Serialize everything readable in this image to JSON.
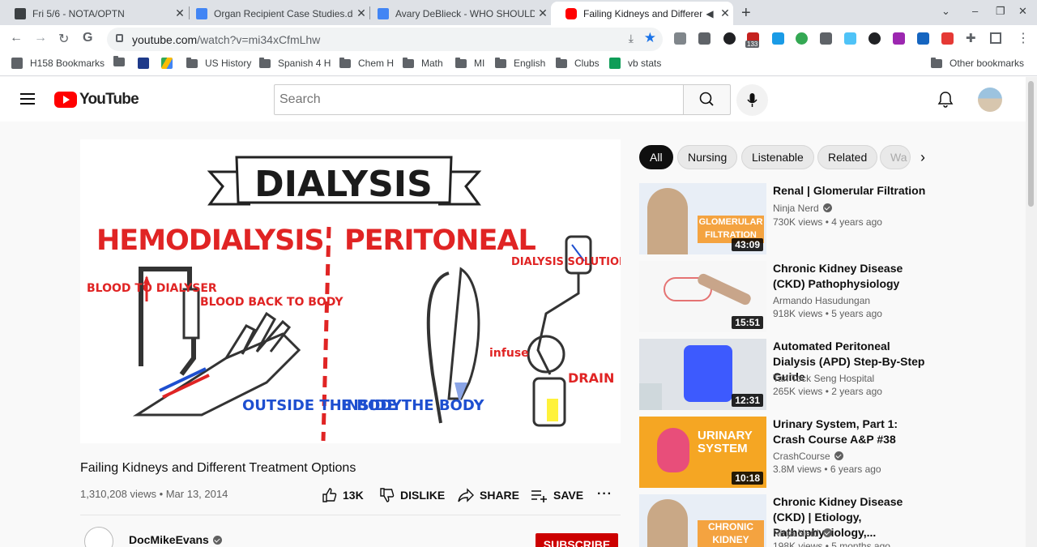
{
  "browser": {
    "tabs": [
      {
        "title": "Fri 5/6 - NOTA/OPTN",
        "active": false
      },
      {
        "title": "Organ Recipient Case Studies.do",
        "active": false
      },
      {
        "title": "Avary DeBlieck - WHO SHOULD R",
        "active": false
      },
      {
        "title": "Failing Kidneys and Differen",
        "active": true
      }
    ],
    "url_host": "youtube.com",
    "url_path": "/watch?v=mi34xCfmLhw",
    "extension_badge": "133",
    "bookmarks": [
      {
        "label": "H158 Bookmarks",
        "type": "special"
      },
      {
        "label": "",
        "type": "folder"
      },
      {
        "label": "",
        "type": "p-icon"
      },
      {
        "label": "",
        "type": "drive-icon"
      },
      {
        "label": "US History",
        "type": "folder"
      },
      {
        "label": "Spanish 4 H",
        "type": "folder"
      },
      {
        "label": "Chem H",
        "type": "folder"
      },
      {
        "label": "Math",
        "type": "folder"
      },
      {
        "label": "MI",
        "type": "folder"
      },
      {
        "label": "English",
        "type": "folder"
      },
      {
        "label": "Clubs",
        "type": "folder"
      },
      {
        "label": "vb stats",
        "type": "sheets"
      },
      {
        "label": "Other bookmarks",
        "type": "folder"
      }
    ]
  },
  "youtube": {
    "logo": "YouTube",
    "search_placeholder": "Search",
    "player": {
      "heading": "DIALYSIS",
      "left_title": "HEMODIALYSIS",
      "right_title": "PERITONEAL",
      "label_blood_to": "BLOOD TO DIALYSER",
      "label_blood_back": "BLOOD BACK TO BODY",
      "label_outside": "OUTSIDE THE BODY",
      "label_inside": "INSIDE THE BODY",
      "label_solution": "DIALYSIS SOLUTION",
      "label_infuse": "infuse",
      "label_drain": "DRAIN"
    },
    "video": {
      "title": "Failing Kidneys and Different Treatment Options",
      "meta": "1,310,208 views • Mar 13, 2014",
      "like_count": "13K",
      "dislike": "DISLIKE",
      "share": "SHARE",
      "save": "SAVE",
      "channel": "DocMikeEvans",
      "subscribe": "SUBSCRIBE"
    },
    "chips": [
      "All",
      "Nursing",
      "Listenable",
      "Related",
      "Wa"
    ],
    "related": [
      {
        "title": "Renal | Glomerular Filtration",
        "channel": "Ninja Nerd",
        "verified": true,
        "stats": "730K views • 4 years ago",
        "duration": "43:09",
        "thumb_text": "GLOMERULAR FILTRATION"
      },
      {
        "title": "Chronic Kidney Disease (CKD) Pathophysiology",
        "channel": "Armando Hasudungan",
        "verified": false,
        "stats": "918K views • 5 years ago",
        "duration": "15:51"
      },
      {
        "title": "Automated Peritoneal Dialysis (APD) Step-By-Step Guide",
        "channel": "Tan Tock Seng Hospital",
        "verified": false,
        "stats": "265K views • 2 years ago",
        "duration": "12:31"
      },
      {
        "title": "Urinary System, Part 1: Crash Course A&P #38",
        "channel": "CrashCourse",
        "verified": true,
        "stats": "3.8M views • 6 years ago",
        "duration": "10:18",
        "thumb_text": "URINARY SYSTEM"
      },
      {
        "title": "Chronic Kidney Disease (CKD) | Etiology, Pathophysiology,...",
        "channel": "Ninja Nerd",
        "verified": true,
        "stats": "198K views • 5 months ago",
        "duration": "",
        "thumb_text": "CHRONIC KIDNEY"
      }
    ]
  }
}
